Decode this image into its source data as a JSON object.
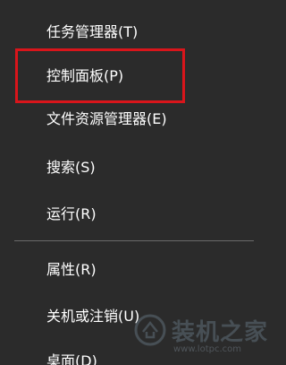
{
  "menu": {
    "items": [
      {
        "label": "任务管理器(T)"
      },
      {
        "label": "控制面板(P)"
      },
      {
        "label": "文件资源管理器(E)"
      },
      {
        "label": "搜索(S)"
      },
      {
        "label": "运行(R)"
      },
      {
        "label": "属性(R)"
      },
      {
        "label": "关机或注销(U)"
      },
      {
        "label": "桌面(D)"
      }
    ],
    "highlighted_item": "控制面板(P)",
    "highlight_color": "#d9151b"
  },
  "watermark": {
    "text": "装机之家",
    "url": "www.lotpc.com"
  }
}
